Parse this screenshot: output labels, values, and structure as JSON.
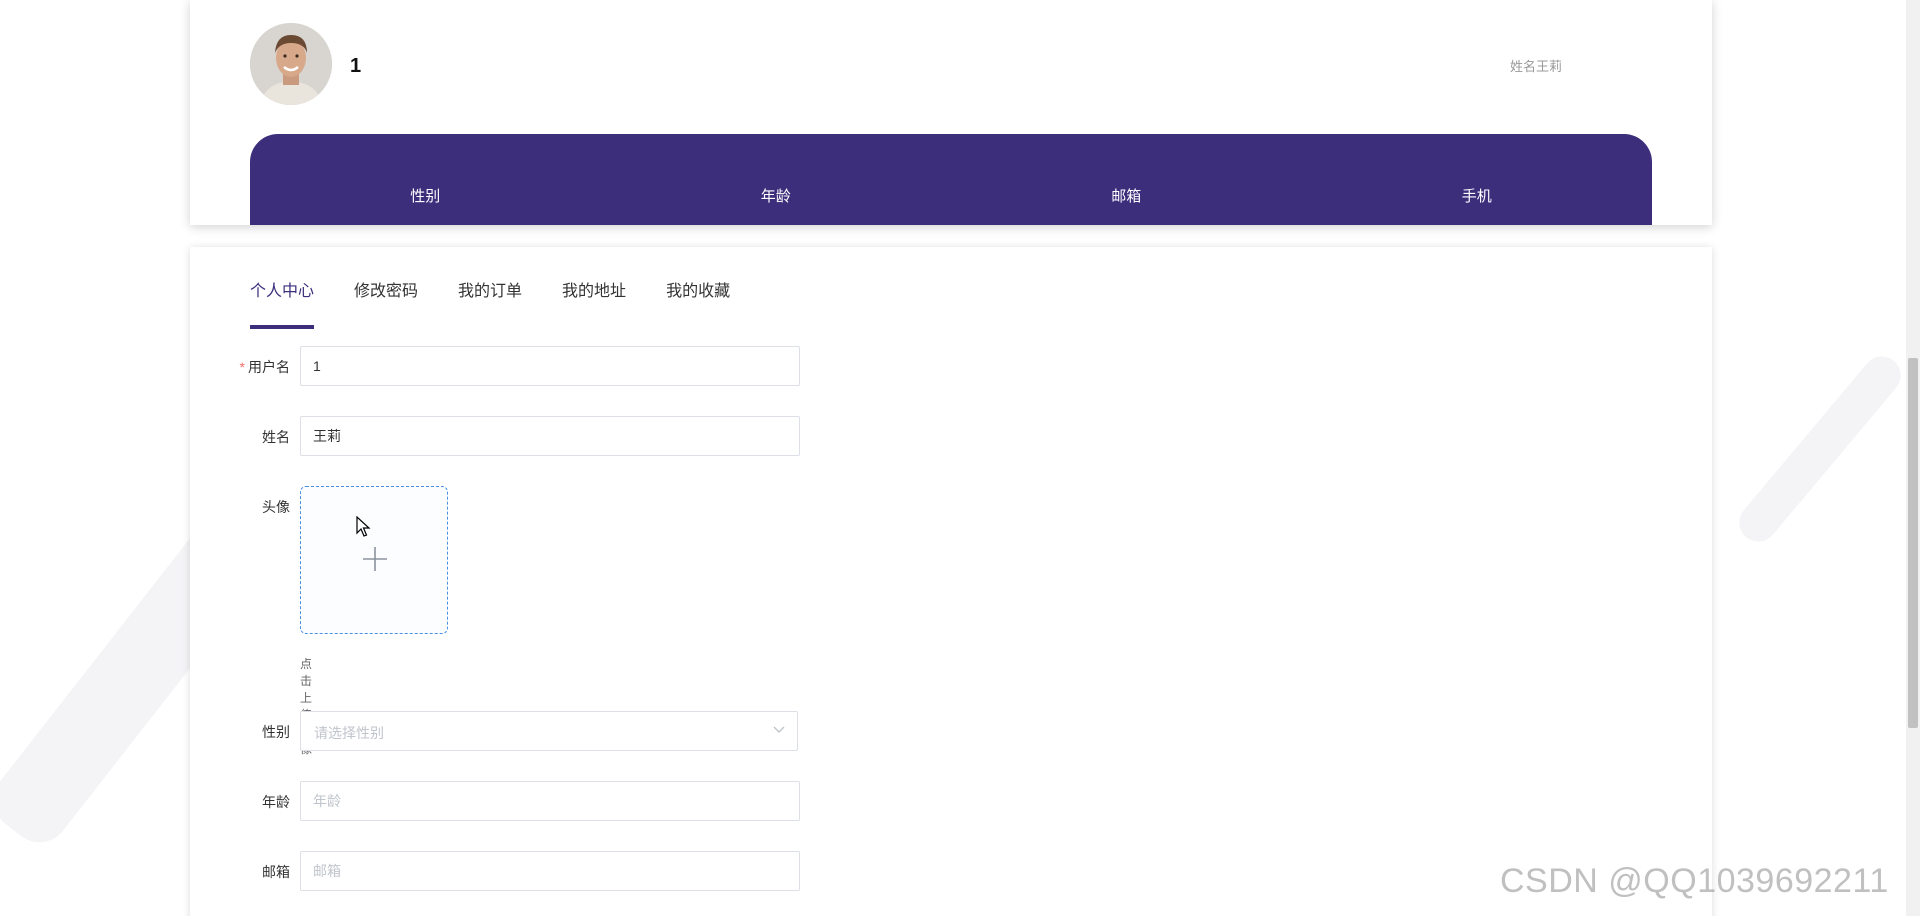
{
  "profile": {
    "username": "1",
    "name_display": "姓名王莉",
    "info_labels": [
      "性别",
      "年龄",
      "邮箱",
      "手机"
    ]
  },
  "tabs": [
    {
      "label": "个人中心",
      "active": true
    },
    {
      "label": "修改密码",
      "active": false
    },
    {
      "label": "我的订单",
      "active": false
    },
    {
      "label": "我的地址",
      "active": false
    },
    {
      "label": "我的收藏",
      "active": false
    }
  ],
  "form": {
    "username": {
      "label": "用户名",
      "required_mark": "*",
      "value": "1"
    },
    "name": {
      "label": "姓名",
      "value": "王莉"
    },
    "avatar": {
      "label": "头像",
      "hint": "点击上传头像",
      "icon": "plus-icon"
    },
    "gender": {
      "label": "性别",
      "placeholder": "请选择性别"
    },
    "age": {
      "label": "年龄",
      "placeholder": "年龄"
    },
    "email": {
      "label": "邮箱",
      "placeholder": "邮箱"
    }
  },
  "watermark": "CSDN @QQ1039692211",
  "colors": {
    "accent": "#3d2e7c",
    "upload_border": "#4a90e2",
    "required": "#f56c6c"
  }
}
